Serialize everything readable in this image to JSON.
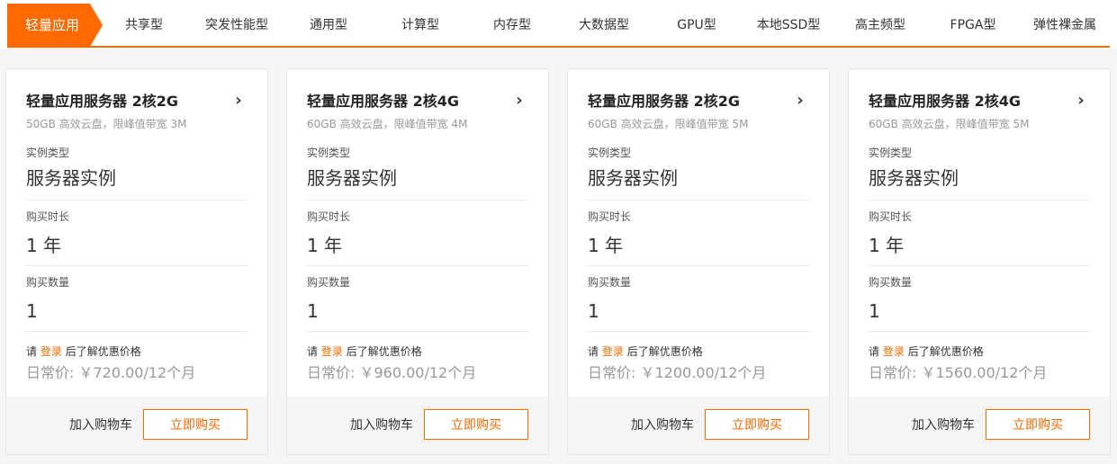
{
  "tabs": [
    {
      "label": "轻量应用",
      "active": true
    },
    {
      "label": "共享型"
    },
    {
      "label": "突发性能型"
    },
    {
      "label": "通用型"
    },
    {
      "label": "计算型"
    },
    {
      "label": "内存型"
    },
    {
      "label": "大数据型"
    },
    {
      "label": "GPU型"
    },
    {
      "label": "本地SSD型"
    },
    {
      "label": "高主频型"
    },
    {
      "label": "FPGA型"
    },
    {
      "label": "弹性裸金属"
    }
  ],
  "common": {
    "instance_type_label": "实例类型",
    "duration_label": "购买时长",
    "quantity_label": "购买数量",
    "login_prefix": "请",
    "login_link": "登录",
    "login_suffix": "后了解优惠价格",
    "cart_label": "加入购物车",
    "buy_label": "立即购买"
  },
  "cards": [
    {
      "title": "轻量应用服务器 2核2G",
      "desc": "50GB 高效云盘，限峰值带宽 3M",
      "instance_type": "服务器实例",
      "duration": "1 年",
      "quantity": "1",
      "price": "日常价: ￥720.00/12个月"
    },
    {
      "title": "轻量应用服务器 2核4G",
      "desc": "60GB 高效云盘，限峰值带宽 4M",
      "instance_type": "服务器实例",
      "duration": "1 年",
      "quantity": "1",
      "price": "日常价: ￥960.00/12个月"
    },
    {
      "title": "轻量应用服务器 2核2G",
      "desc": "60GB 高效云盘，限峰值带宽 5M",
      "instance_type": "服务器实例",
      "duration": "1 年",
      "quantity": "1",
      "price": "日常价: ￥1200.00/12个月"
    },
    {
      "title": "轻量应用服务器 2核4G",
      "desc": "60GB 高效云盘，限峰值带宽 5M",
      "instance_type": "服务器实例",
      "duration": "1 年",
      "quantity": "1",
      "price": "日常价: ￥1560.00/12个月"
    }
  ],
  "colors": {
    "accent": "#ff6a00",
    "muted": "#999999"
  },
  "icons": {
    "card_arrow": "chevron-right-icon"
  }
}
